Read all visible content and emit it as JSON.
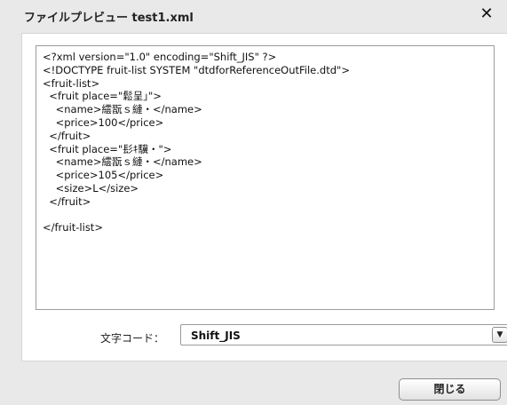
{
  "window": {
    "title": "ファイルプレビュー test1.xml",
    "close_icon": "close-icon"
  },
  "preview": {
    "content": "<?xml version=\"1.0\" encoding=\"Shift_JIS\" ?>\n<!DOCTYPE fruit-list SYSTEM \"dtdforReferenceOutFile.dtd\">\n<fruit-list>\n  <fruit place=\"鬆呈｣\">\n    <name>繧翫ｓ縺・</name>\n    <price>100</price>\n  </fruit>\n  <fruit place=\"髟ｷ驥・\">\n    <name>繧翫ｓ縺・</name>\n    <price>105</price>\n    <size>L</size>\n  </fruit>\n\n</fruit-list>"
  },
  "encoding": {
    "label": "文字コード：",
    "selected": "Shift_JIS",
    "dropdown_icon": "chevron-down-icon"
  },
  "footer": {
    "close_label": "閉じる"
  }
}
